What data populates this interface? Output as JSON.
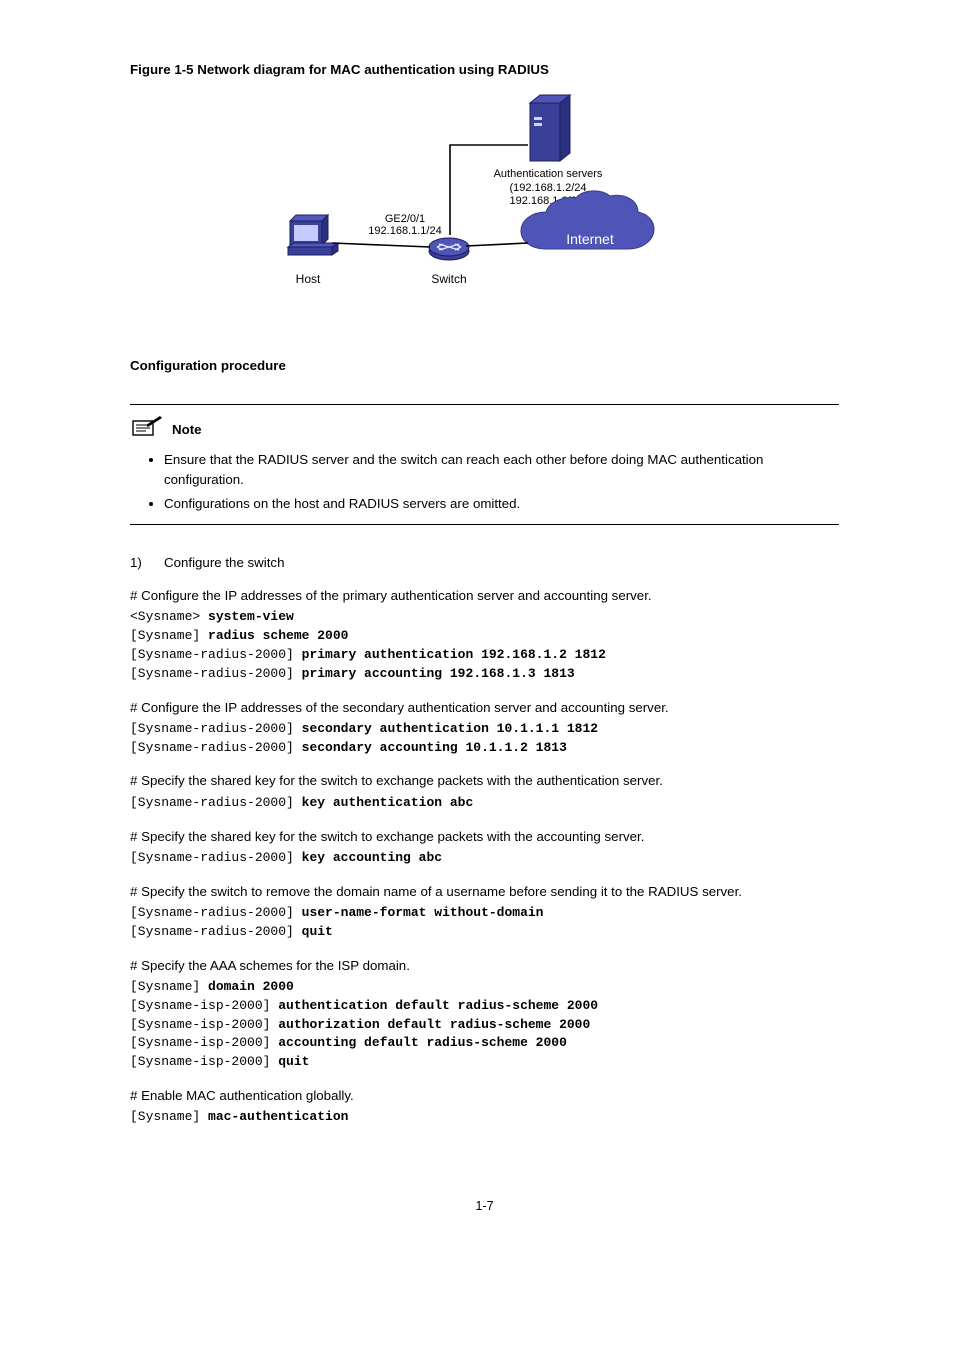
{
  "figureTitle": "Figure 1-5 Network diagram for MAC authentication using RADIUS",
  "diagram": {
    "host": "Host",
    "switch": "Switch",
    "ifaceLine1": "GE2/0/1",
    "ifaceLine2": "192.168.1.1/24",
    "authServers": "Authentication servers",
    "authIpsLine1": "(192.168.1.2/24",
    "authIpsLine2": "192.168.1.3/24)",
    "internet": "Internet"
  },
  "configProcHeader": "Configuration procedure",
  "noteLabel": "Note",
  "noteBullets": [
    "Ensure that the RADIUS server and the switch can reach each other before doing MAC authentication configuration.",
    "Configurations on the host and RADIUS servers are omitted."
  ],
  "step1": "1)",
  "step1Label": "Configure the switch",
  "cmds": {
    "c0d": "# Configure the IP addresses of the primary authentication server and accounting server.",
    "c0p": "<Sysname> system-view\n[Sysname] radius scheme 2000\n[Sysname-radius-2000] primary authentication 192.168.1.2 1812\n[Sysname-radius-2000] primary accounting 192.168.1.3 1813",
    "c1d": "# Configure the IP addresses of the secondary authentication server and accounting server.",
    "c1p": "[Sysname-radius-2000] secondary authentication 10.1.1.1 1812\n[Sysname-radius-2000] secondary accounting 10.1.1.2 1813",
    "c2d": "# Specify the shared key for the switch to exchange packets with the authentication server.",
    "c2p": "[Sysname-radius-2000] key authentication abc",
    "c3d": "# Specify the shared key for the switch to exchange packets with the accounting server.",
    "c3p": "[Sysname-radius-2000] key accounting abc",
    "c4d": "# Specify the switch to remove the domain name of a username before sending it to the RADIUS server.",
    "c4p": "[Sysname-radius-2000] user-name-format without-domain\n[Sysname-radius-2000] quit",
    "c5d": "# Specify the AAA schemes for the ISP domain.",
    "c5p": "[Sysname] domain 2000\n[Sysname-isp-2000] authentication default radius-scheme 2000\n[Sysname-isp-2000] authorization default radius-scheme 2000\n[Sysname-isp-2000] accounting default radius-scheme 2000\n[Sysname-isp-2000] quit",
    "c6d": "# Enable MAC authentication globally.",
    "c6p": "[Sysname] mac-authentication"
  },
  "pageNumber": "1-7"
}
